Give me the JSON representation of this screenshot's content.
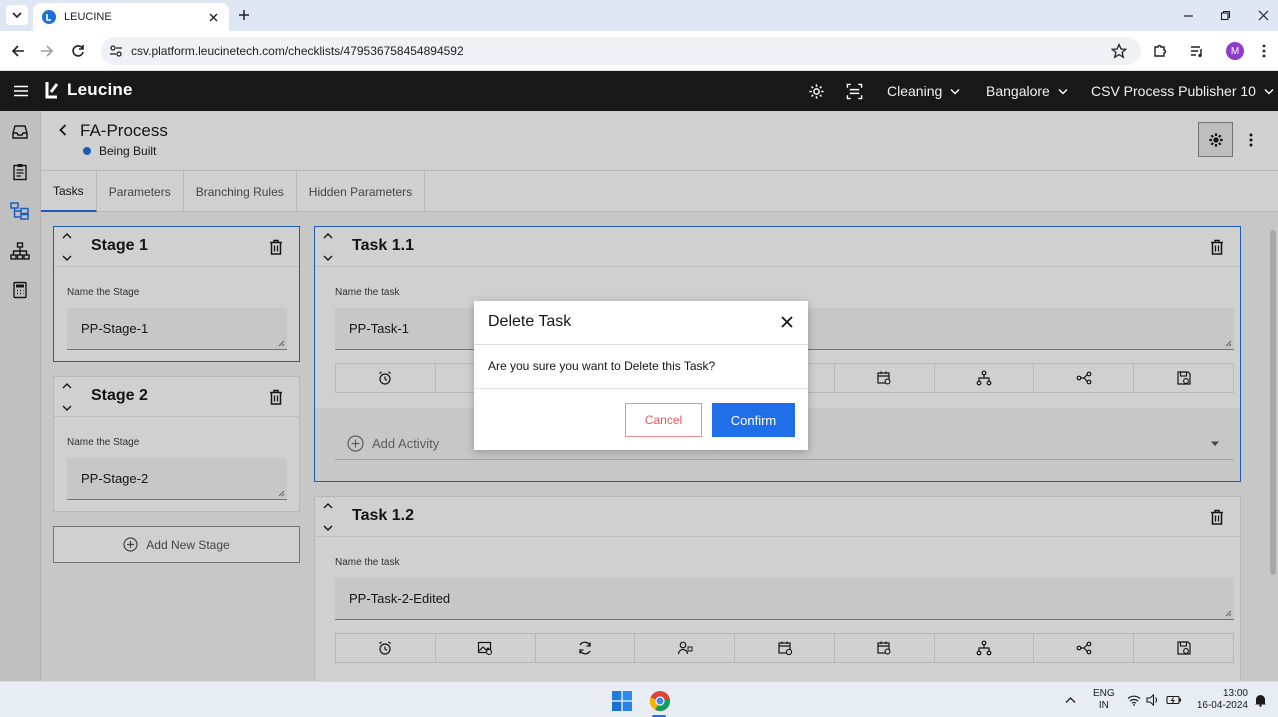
{
  "browser": {
    "tab_title": "LEUCINE",
    "url": "csv.platform.leucinetech.com/checklists/479536758454894592",
    "profile_initial": "M"
  },
  "header": {
    "brand": "Leucine",
    "facility_select": "Cleaning",
    "site_select": "Bangalore",
    "user_select": "CSV Process Publisher 10"
  },
  "page": {
    "title": "FA-Process",
    "status": "Being Built",
    "status_color": "#1f6fe8"
  },
  "tabs": [
    "Tasks",
    "Parameters",
    "Branching Rules",
    "Hidden Parameters"
  ],
  "stages": [
    {
      "title": "Stage 1",
      "field_label": "Name the Stage",
      "value": "PP-Stage-1"
    },
    {
      "title": "Stage 2",
      "field_label": "Name the Stage",
      "value": "PP-Stage-2"
    }
  ],
  "add_stage_label": "Add New Stage",
  "tasks": [
    {
      "title": "Task 1.1",
      "field_label": "Name the task",
      "value": "PP-Task-1",
      "add_activity_label": "Add Activity"
    },
    {
      "title": "Task 1.2",
      "field_label": "Name the task",
      "value": "PP-Task-2-Edited"
    }
  ],
  "task_toolbar_icons": [
    "alarm-icon",
    "image-icon",
    "recurrence-icon",
    "assignee-icon",
    "schedule-icon",
    "due-date-icon",
    "branch-icon",
    "flow-icon",
    "save-icon"
  ],
  "modal": {
    "title": "Delete Task",
    "message": "Are you sure you want to Delete this Task?",
    "cancel_label": "Cancel",
    "confirm_label": "Confirm"
  },
  "taskbar": {
    "lang_line1": "ENG",
    "lang_line2": "IN",
    "time": "13:00",
    "date": "16-04-2024"
  },
  "colors": {
    "accent": "#1f6fe8",
    "header_bg": "#181818",
    "danger": "#e85a5a"
  }
}
